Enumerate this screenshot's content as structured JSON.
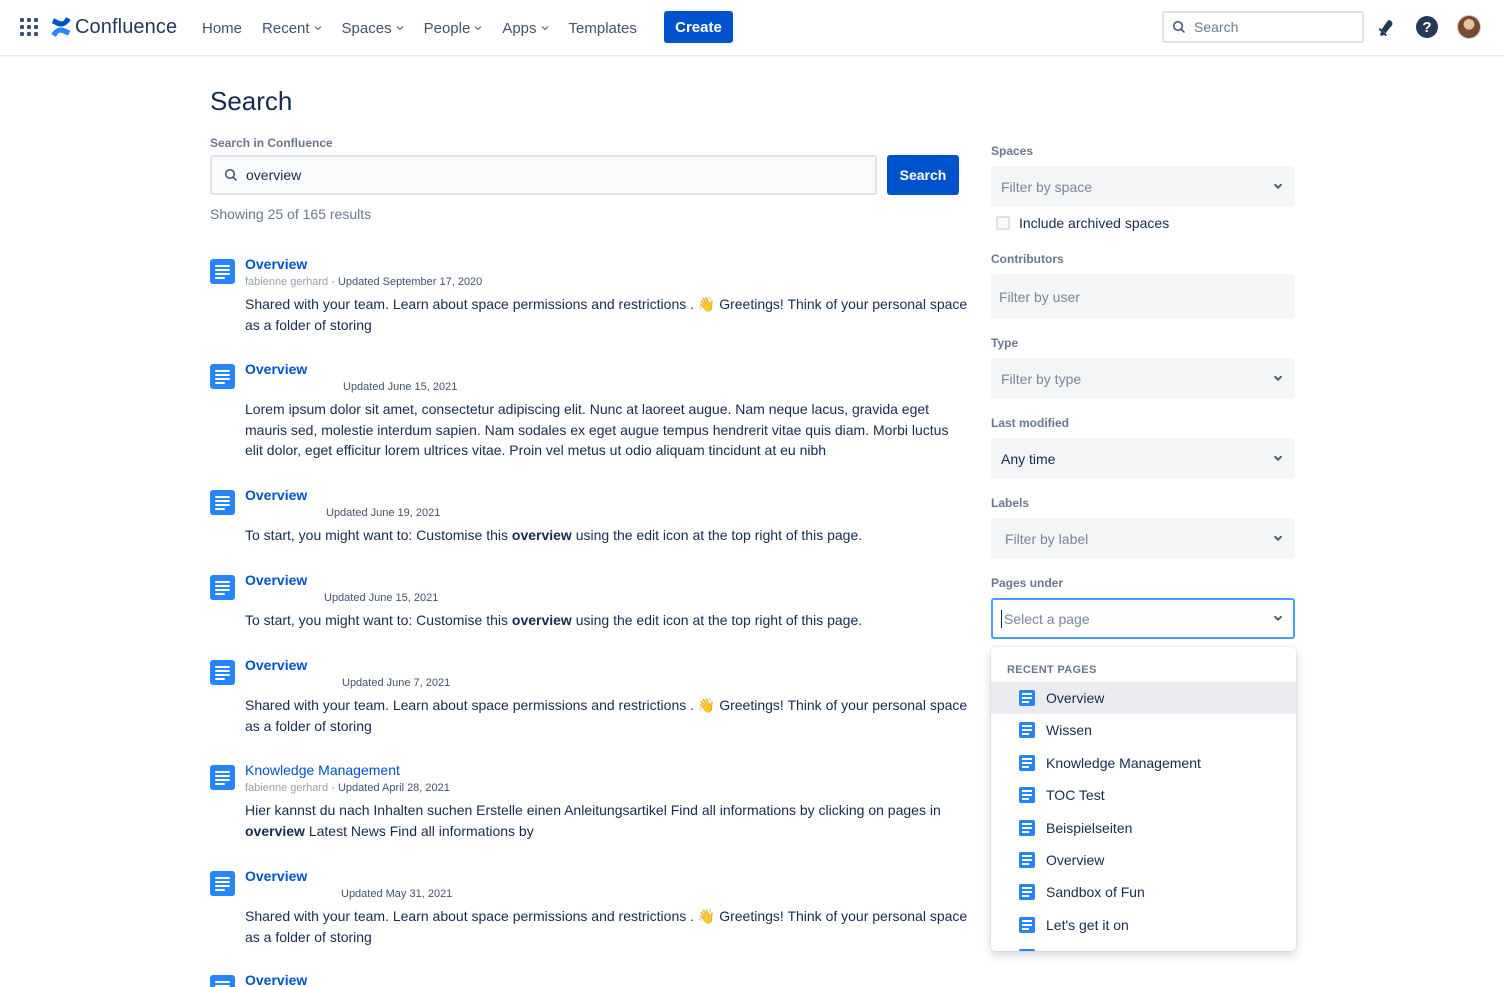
{
  "nav": {
    "logo_text": "Confluence",
    "items": [
      "Home",
      "Recent",
      "Spaces",
      "People",
      "Apps",
      "Templates"
    ],
    "create_label": "Create",
    "search_placeholder": "Search",
    "help_label": "?"
  },
  "main": {
    "title": "Search",
    "search_label": "Search in Confluence",
    "search_value": "overview",
    "search_button": "Search",
    "results_count": "Showing 25 of 165 results"
  },
  "results": [
    {
      "title": "Overview",
      "author": "fabienne gerhard",
      "sep": " · ",
      "updated": "Updated September 17, 2020",
      "excerpt": "Shared with your team. Learn about space permissions and restrictions . 👋 Greetings! Think of your personal space as a folder of storing"
    },
    {
      "title": "Overview",
      "author": "",
      "sep": "",
      "updated": "Updated June 15, 2021",
      "excerpt": "Lorem ipsum dolor sit amet, consectetur adipiscing elit. Nunc at laoreet augue. Nam neque lacus, gravida eget mauris sed, molestie interdum sapien. Nam sodales ex eget augue tempus hendrerit vitae quis diam. Morbi luctus elit dolor, eget efficitur lorem ultrices vitae. Proin vel metus ut odio aliquam tincidunt at eu nibh"
    },
    {
      "title": "Overview",
      "author": "",
      "sep": "",
      "updated": "Updated June 19, 2021",
      "excerpt_before": "To start, you might want to: Customise this ",
      "excerpt_bold": "overview",
      "excerpt_after": " using the edit icon at the top right of this page."
    },
    {
      "title": "Overview",
      "author": "",
      "sep": "",
      "updated": "Updated June 15, 2021",
      "excerpt_before": "To start, you might want to: Customise this ",
      "excerpt_bold": "overview",
      "excerpt_after": " using the edit icon at the top right of this page."
    },
    {
      "title": "Overview",
      "author": "",
      "sep": "",
      "updated": "Updated June 7, 2021",
      "excerpt": "Shared with your team. Learn about space permissions and restrictions . 👋 Greetings! Think of your personal space as a folder of storing"
    },
    {
      "title": "Knowledge Management",
      "author": "fabienne gerhard",
      "sep": " · ",
      "updated": "Updated April 28, 2021",
      "excerpt_before": "Hier kannst du nach Inhalten suchen Erstelle einen Anleitungsartikel Find all informations by clicking on pages in ",
      "excerpt_bold": "overview",
      "excerpt_after": " Latest News Find all informations by"
    },
    {
      "title": "Overview",
      "author": "",
      "sep": "",
      "updated": "Updated May 31, 2021",
      "excerpt": "Shared with your team. Learn about space permissions and restrictions . 👋 Greetings! Think of your personal space as a folder of storing"
    },
    {
      "title": "Overview"
    }
  ],
  "filters": {
    "spaces_label": "Spaces",
    "spaces_placeholder": "Filter by space",
    "archived_label": "Include archived spaces",
    "contributors_label": "Contributors",
    "contributors_placeholder": "Filter by user",
    "type_label": "Type",
    "type_placeholder": "Filter by type",
    "modified_label": "Last modified",
    "modified_value": "Any time",
    "labels_label": "Labels",
    "labels_placeholder": "Filter by label",
    "pages_under_label": "Pages under",
    "pages_under_placeholder": "Select a page"
  },
  "dropdown": {
    "heading": "RECENT PAGES",
    "items": [
      "Overview",
      "Wissen",
      "Knowledge Management",
      "TOC Test",
      "Beispielseiten",
      "Overview",
      "Sandbox of Fun",
      "Let's get it on"
    ]
  },
  "colors": {
    "brand": "#0052cc",
    "doc_icon": "#2684ff",
    "focus": "#4c9aff"
  }
}
